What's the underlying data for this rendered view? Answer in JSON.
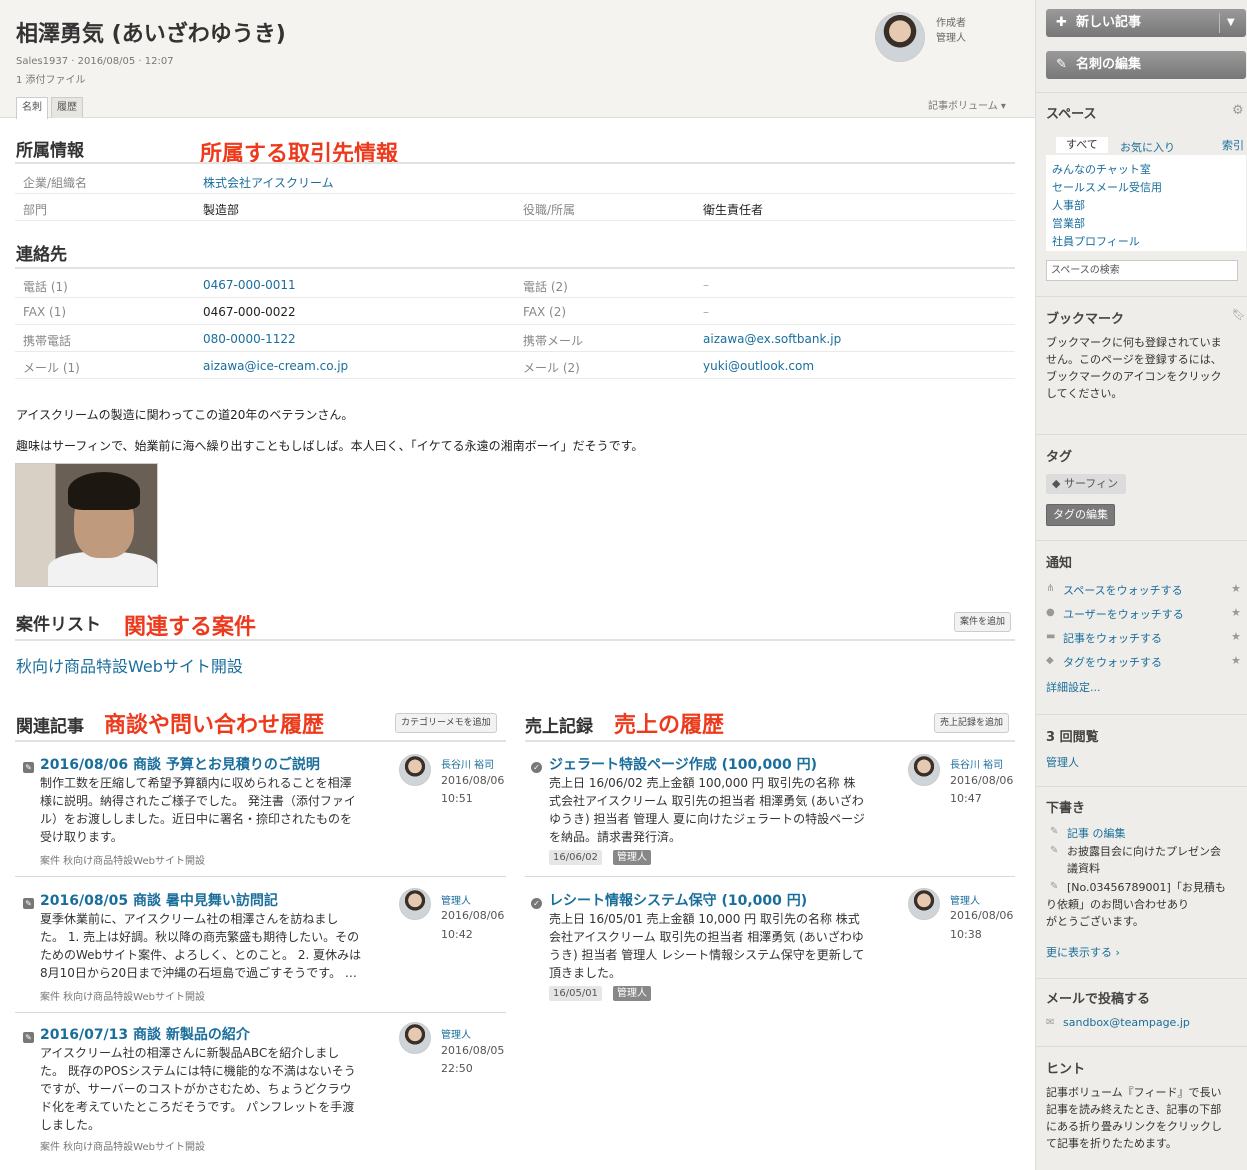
{
  "header": {
    "title": "相澤勇気 (あいざわゆうき)",
    "meta_line1": "Sales1937 · 2016/08/05 · 12:07",
    "meta_line2": "1 添付ファイル",
    "author_role": "作成者",
    "author_name": "管理人",
    "tabs": [
      "名刺",
      "履歴"
    ],
    "volume_label": "記事ボリューム ▾"
  },
  "affiliation": {
    "heading": "所属情報",
    "annotation": "所属する取引先情報",
    "company_label": "企業/組織名",
    "company_value": "株式会社アイスクリーム",
    "dept_label": "部門",
    "dept_value": "製造部",
    "title_label": "役職/所属",
    "title_value": "衛生責任者"
  },
  "contact": {
    "heading": "連絡先",
    "rows": [
      {
        "l1": "電話 (1)",
        "v1": "0467-000-0011",
        "l2": "電話 (2)",
        "v2": "–"
      },
      {
        "l1": "FAX (1)",
        "v1": "0467-000-0022",
        "l2": "FAX (2)",
        "v2": "–"
      },
      {
        "l1": "携帯電話",
        "v1": "080-0000-1122",
        "l2": "携帯メール",
        "v2": "aizawa@ex.softbank.jp"
      },
      {
        "l1": "メール (1)",
        "v1": "aizawa@ice-cream.co.jp",
        "l2": "メール (2)",
        "v2": "yuki@outlook.com"
      }
    ]
  },
  "description": {
    "p1": "アイスクリームの製造に関わってこの道20年のベテランさん。",
    "p2": "趣味はサーフィンで、始業前に海へ繰り出すこともしばしば。本人曰く、「イケてる永遠の湘南ボーイ」だそうです。"
  },
  "cases": {
    "heading": "案件リスト",
    "annotation": "関連する案件",
    "add_button": "案件を追加",
    "items": [
      "秋向け商品特設Webサイト開設"
    ]
  },
  "related": {
    "heading": "関連記事",
    "annotation": "商談や問い合わせ履歴",
    "add_button": "カテゴリーメモを追加",
    "articles": [
      {
        "title": "2016/08/06 商談 予算とお見積りのご説明",
        "lines": [
          "制作工数を圧縮して希望予算額内に収められることを相澤",
          "様に説明。納得されたご様子でした。 発注書（添付ファイ",
          "ル）をお渡ししました。近日中に署名・捺印されたものを",
          "受け取ります。"
        ],
        "category": "案件 秋向け商品特設Webサイト開設",
        "author": "長谷川 裕司",
        "date": "2016/08/06",
        "time": "10:51"
      },
      {
        "title": "2016/08/05 商談 暑中見舞い訪問記",
        "lines": [
          "夏季休業前に、アイスクリーム社の相澤さんを訪ねまし",
          "た。 1. 売上は好調。秋以降の商売繁盛も期待したい。その",
          "ためのWebサイト案件、よろしく、とのこと。 2. 夏休みは",
          "8月10日から20日まで沖縄の石垣島で過ごすそうです。 …"
        ],
        "category": "案件 秋向け商品特設Webサイト開設",
        "author": "管理人",
        "date": "2016/08/06",
        "time": "10:42"
      },
      {
        "title": "2016/07/13 商談 新製品の紹介",
        "lines": [
          "アイスクリーム社の相澤さんに新製品ABCを紹介しまし",
          "た。 既存のPOSシステムには特に機能的な不満はないそう",
          "ですが、サーバーのコストがかさむため、ちょうどクラウ",
          "ド化を考えていたところだそうです。 パンフレットを手渡",
          "しました。"
        ],
        "category": "案件 秋向け商品特設Webサイト開設",
        "author": "管理人",
        "date": "2016/08/05",
        "time": "22:50"
      }
    ]
  },
  "sales": {
    "heading": "売上記録",
    "annotation": "売上の履歴",
    "add_button": "売上記録を追加",
    "records": [
      {
        "title": "ジェラート特設ページ作成 (100,000 円)",
        "lines": [
          "売上日 16/06/02 売上金額 100,000 円 取引先の名称 株",
          "式会社アイスクリーム 取引先の担当者 相澤勇気 (あいざわ",
          "ゆうき) 担当者 管理人 夏に向けたジェラートの特設ページ",
          "を納品。請求書発行済。"
        ],
        "chip_date": "16/06/02",
        "chip_user": "管理人",
        "author": "長谷川 裕司",
        "date": "2016/08/06",
        "time": "10:47"
      },
      {
        "title": "レシート情報システム保守 (10,000 円)",
        "lines": [
          "売上日 16/05/01 売上金額 10,000 円 取引先の名称 株式",
          "会社アイスクリーム 取引先の担当者 相澤勇気 (あいざわゆ",
          "うき) 担当者 管理人 レシート情報システム保守を更新して",
          "頂きました。"
        ],
        "chip_date": "16/05/01",
        "chip_user": "管理人",
        "author": "管理人",
        "date": "2016/08/06",
        "time": "10:38"
      }
    ]
  },
  "sidebar": {
    "new_article": "新しい記事",
    "edit_card": "名刺の編集",
    "space_heading": "スペース",
    "space_tabs": [
      "すべて",
      "お気に入り",
      "索引"
    ],
    "spaces": [
      "みんなのチャット室",
      "セールスメール受信用",
      "人事部",
      "営業部",
      "社員プロフィール"
    ],
    "space_search_placeholder": "スペースの検索",
    "bookmark_heading": "ブックマーク",
    "bookmark_lines": [
      "ブックマークに何も登録されていま",
      "せん。このページを登録するには、",
      "ブックマークのアイコンをクリック",
      "してください。"
    ],
    "tag_heading": "タグ",
    "tag": "サーフィン",
    "tag_edit": "タグの編集",
    "notify_heading": "通知",
    "watch": [
      "スペースをウォッチする",
      "ユーザーをウォッチする",
      "記事をウォッチする",
      "タグをウォッチする"
    ],
    "detail_settings": "詳細設定...",
    "views_heading": "3 回閲覧",
    "viewer": "管理人",
    "drafts_heading": "下書き",
    "drafts": [
      {
        "lines": [
          "記事 の編集"
        ]
      },
      {
        "lines": [
          "お披露目会に向けたプレゼン会",
          "議資料"
        ]
      },
      {
        "lines": [
          "[No.03456789001]「お見積も",
          "り依頼」のお問い合わせあり",
          "がとうございます。"
        ]
      }
    ],
    "more": "更に表示する ›",
    "mail_heading": "メールで投稿する",
    "mail_address": "sandbox@teampage.jp",
    "hint_heading": "ヒント",
    "hint_lines": [
      "記事ボリューム『フィード』で長い",
      "記事を読み終えたとき、記事の下部",
      "にある折り畳みリンクをクリックし",
      "て記事を折りたためます。"
    ]
  }
}
